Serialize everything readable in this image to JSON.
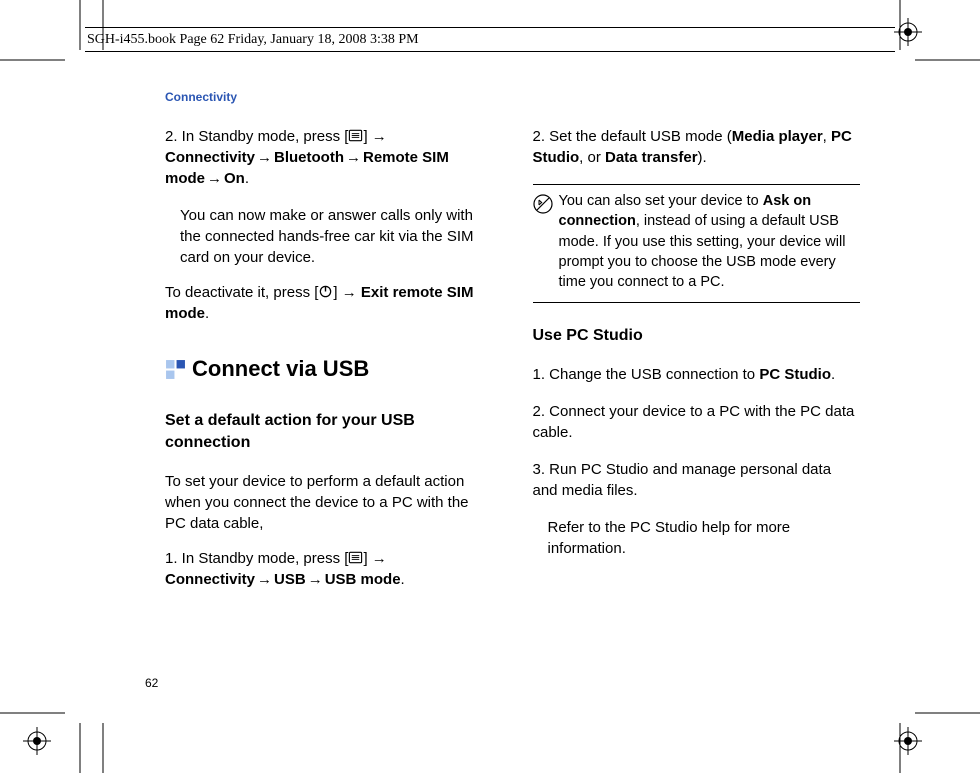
{
  "header": "SGH-i455.book  Page 62  Friday, January 18, 2008  3:38 PM",
  "sectionHead": "Connectivity",
  "pageNumber": "62",
  "left": {
    "step2_a": "2. In Standby mode, press [",
    "step2_b": "] → ",
    "step2_c1": "Connectivity",
    "step2_c2": "Bluetooth",
    "step2_c3": "Remote SIM mode",
    "step2_c4": "On",
    "step2_note": "You can now make or answer calls only with the connected hands-free car kit via the SIM card on your device.",
    "deact_a": "To deactivate it, press [",
    "deact_b": "] → ",
    "deact_bold": "Exit remote SIM mode",
    "h1": "Connect via USB",
    "h2": "Set a default action for your USB connection",
    "p1": "To set your device to perform a default action when you connect the device to a PC with the PC data cable,",
    "s1_a": "1. In Standby mode, press [",
    "s1_b": "] → ",
    "s1_c1": "Connectivity",
    "s1_c2": "USB",
    "s1_c3": "USB mode"
  },
  "right": {
    "s2_a": "2. Set the default USB mode (",
    "s2_b1": "Media player",
    "s2_b2": "PC Studio",
    "s2_b3": "Data transfer",
    "s2_end": ").",
    "note_a": "You can also set your device to ",
    "note_bold": "Ask on connection",
    "note_b": ", instead of using a default USB mode. If you use this setting, your device will prompt you to choose the USB mode every time you connect to a PC.",
    "h2": "Use PC Studio",
    "s1_a": "1. Change the USB connection to ",
    "s1_bold": "PC Studio",
    "s2": "2. Connect your device to a PC with the PC data cable.",
    "s3": "3. Run PC Studio and manage personal data and media files.",
    "refer": "Refer to the PC Studio help for more information."
  }
}
